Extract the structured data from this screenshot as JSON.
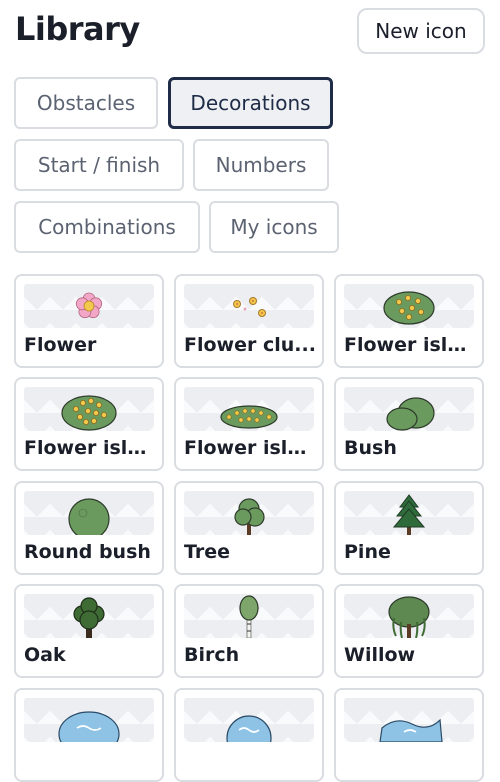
{
  "header": {
    "title": "Library",
    "new_icon_label": "New icon"
  },
  "tabs": [
    {
      "label": "Obstacles",
      "active": false
    },
    {
      "label": "Decorations",
      "active": true
    },
    {
      "label": "Start / finish",
      "active": false
    },
    {
      "label": "Numbers",
      "active": false
    },
    {
      "label": "Combinations",
      "active": false
    },
    {
      "label": "My icons",
      "active": false
    }
  ],
  "icons": [
    {
      "label": "Flower",
      "icon": "flower-icon"
    },
    {
      "label": "Flower clu...",
      "icon": "flower-cluster-icon"
    },
    {
      "label": "Flower isla...",
      "icon": "flower-island-icon"
    },
    {
      "label": "Flower isla...",
      "icon": "flower-island-large-icon"
    },
    {
      "label": "Flower isla...",
      "icon": "flower-island-long-icon"
    },
    {
      "label": "Bush",
      "icon": "bush-icon"
    },
    {
      "label": "Round bush",
      "icon": "round-bush-icon"
    },
    {
      "label": "Tree",
      "icon": "tree-icon"
    },
    {
      "label": "Pine",
      "icon": "pine-icon"
    },
    {
      "label": "Oak",
      "icon": "oak-icon"
    },
    {
      "label": "Birch",
      "icon": "birch-icon"
    },
    {
      "label": "Willow",
      "icon": "willow-icon"
    },
    {
      "label": "",
      "icon": "water-icon"
    },
    {
      "label": "",
      "icon": "water-round-icon"
    },
    {
      "label": "",
      "icon": "water-wave-icon"
    }
  ],
  "colors": {
    "active_tab_border": "#1f2c47",
    "leaf_green": "#6b9a5e",
    "leaf_outline": "#2e3b2b",
    "flower_pink": "#f2a6c8",
    "flower_yellow": "#f2c94c",
    "water_blue": "#8ec3e6"
  }
}
